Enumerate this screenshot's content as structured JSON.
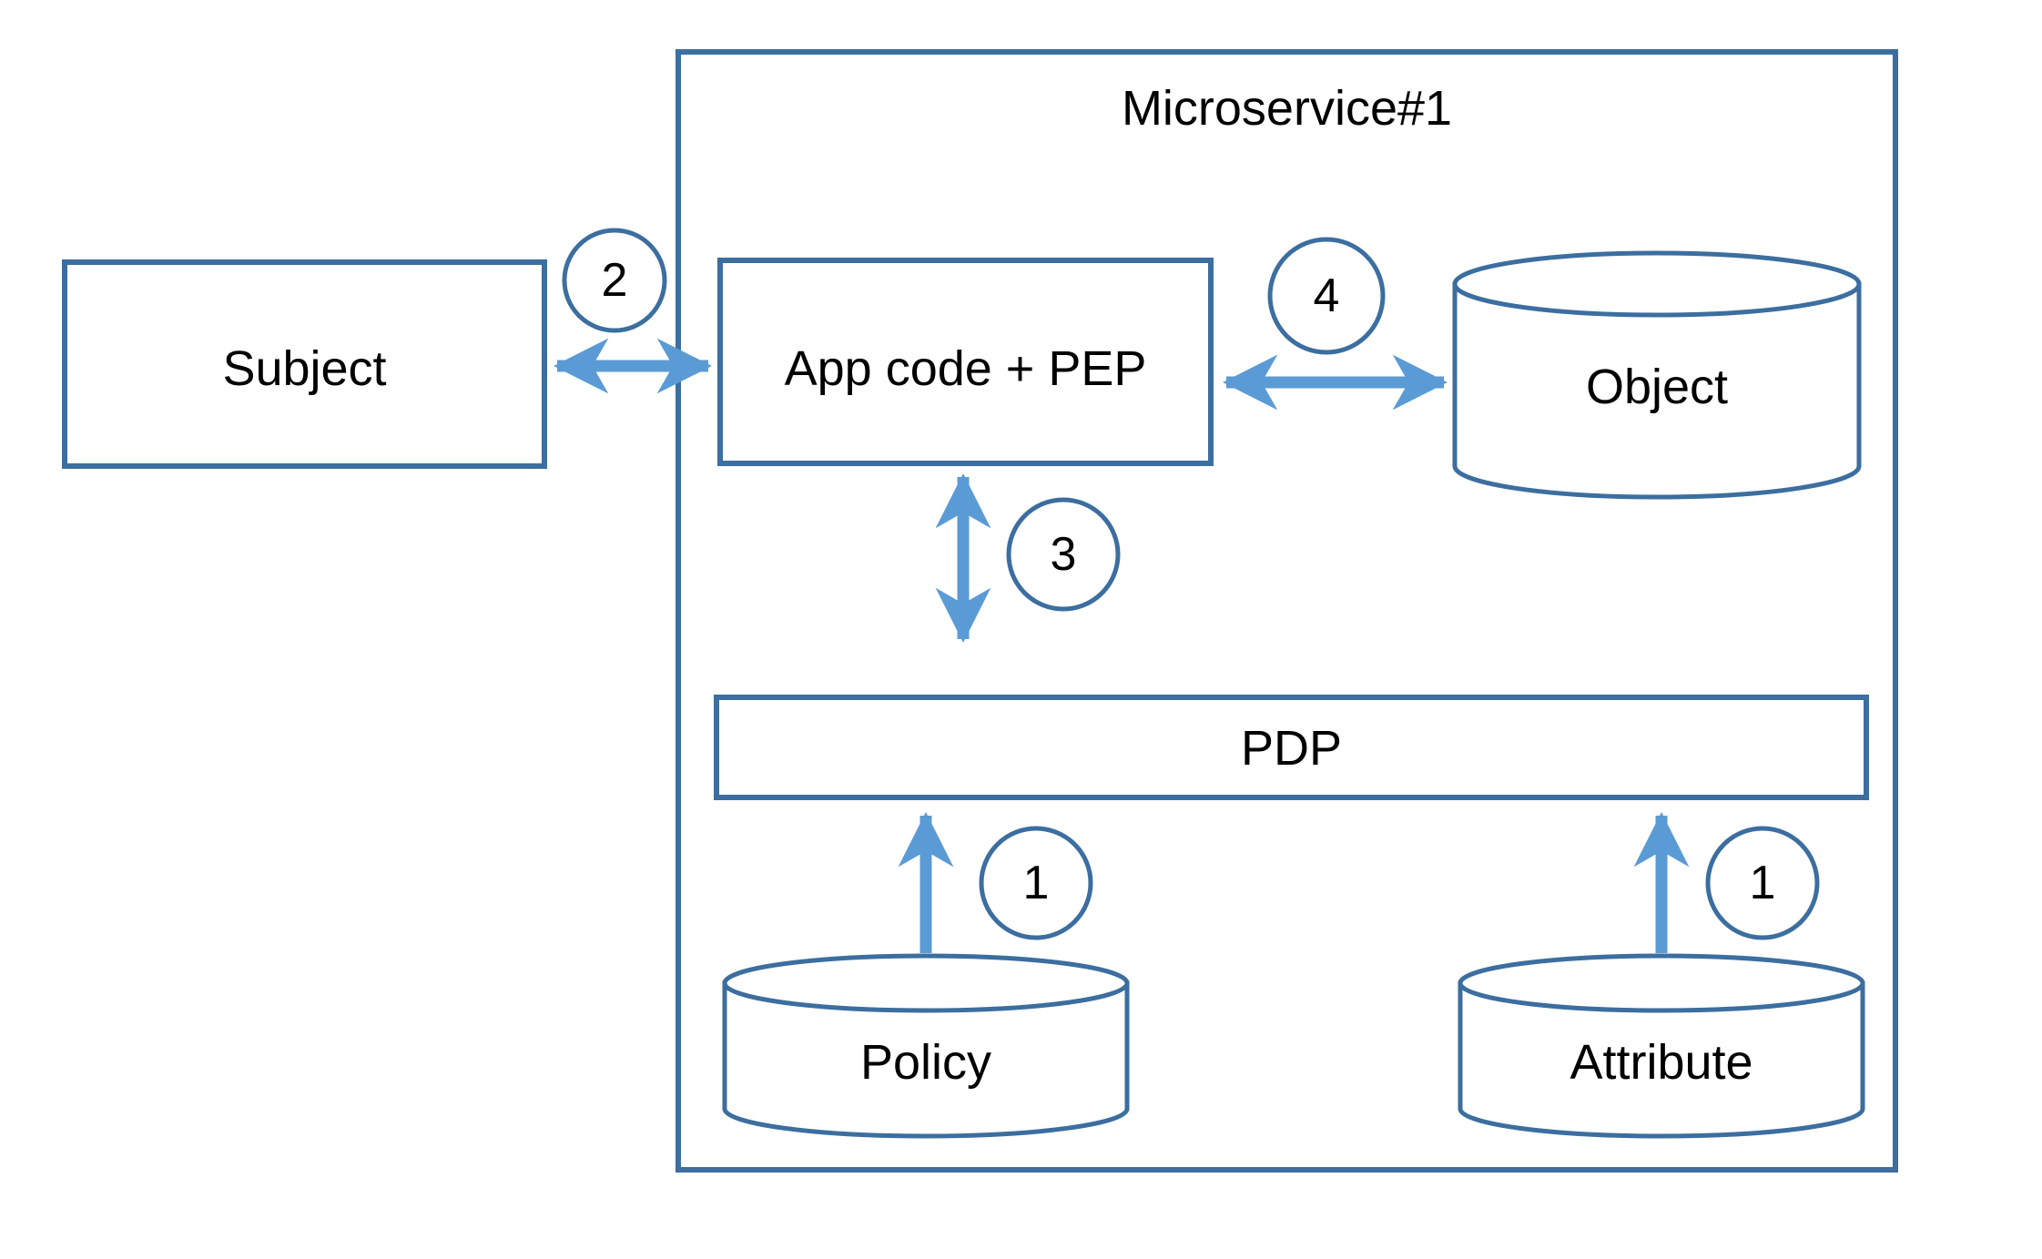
{
  "diagram": {
    "title": "Microservice#1",
    "theme": {
      "shape_stroke": "#3C6E9F",
      "arrow_color": "#5B9BD5",
      "text_color": "#000000",
      "background": "#FFFFFF"
    },
    "nodes": [
      {
        "id": "microservice",
        "label": "Microservice#1",
        "shape": "container"
      },
      {
        "id": "subject",
        "label": "Subject",
        "shape": "rectangle"
      },
      {
        "id": "app_code_pep",
        "label": "App code + PEP",
        "shape": "rectangle"
      },
      {
        "id": "object",
        "label": "Object",
        "shape": "cylinder"
      },
      {
        "id": "pdp",
        "label": "PDP",
        "shape": "rectangle"
      },
      {
        "id": "policy",
        "label": "Policy",
        "shape": "cylinder"
      },
      {
        "id": "attribute",
        "label": "Attribute",
        "shape": "cylinder"
      }
    ],
    "connectors": [
      {
        "id": "c2",
        "badge": "2",
        "from": "subject",
        "to": "app_code_pep",
        "direction": "bidirectional"
      },
      {
        "id": "c4",
        "badge": "4",
        "from": "app_code_pep",
        "to": "object",
        "direction": "bidirectional"
      },
      {
        "id": "c3",
        "badge": "3",
        "from": "app_code_pep",
        "to": "pdp",
        "direction": "bidirectional"
      },
      {
        "id": "c1a",
        "badge": "1",
        "from": "policy",
        "to": "pdp",
        "direction": "unidirectional"
      },
      {
        "id": "c1b",
        "badge": "1",
        "from": "attribute",
        "to": "pdp",
        "direction": "unidirectional"
      }
    ],
    "badges": {
      "step1_policy": "1",
      "step1_attribute": "1",
      "step2": "2",
      "step3": "3",
      "step4": "4"
    }
  }
}
